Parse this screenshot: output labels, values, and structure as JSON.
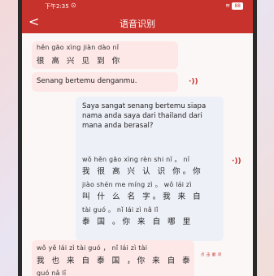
{
  "status": {
    "time": "下午2:35",
    "battery": "88"
  },
  "header": {
    "title": "语音识别",
    "back": "<"
  },
  "messages": [
    {
      "pinyin": "hěn gāo xìng jiàn dào nǐ",
      "hanzi": "很 高 兴 见 到 你",
      "translation": "Senang bertemu denganmu."
    },
    {
      "text": "Saya sangat senang bertemu siapa nama anda saya dari thailand dari mana anda berasal?",
      "lines": [
        {
          "pinyin": "wǒ hěn gāo xìng rèn shi nǐ 。 nǐ",
          "hanzi": "我 很 高 兴 认 识 你。你"
        },
        {
          "pinyin": "jiào shén me míng zì 。 wǒ lái zì",
          "hanzi": "叫 什 么 名 字。我 来 自"
        },
        {
          "pinyin": "tài guó 。 nǐ lái zì nǎ lǐ",
          "hanzi": "泰 国 。你 来 自 哪 里"
        }
      ]
    },
    {
      "lines": [
        {
          "pinyin": "wǒ yě lái zì tài guó ， nǐ lái zì tài",
          "hanzi": "我 也 来 自 泰 国 ，你 来 自 泰"
        },
        {
          "pinyin": "guó nǎ lǐ"
        }
      ],
      "tag": "点 击 翻 译"
    }
  ]
}
